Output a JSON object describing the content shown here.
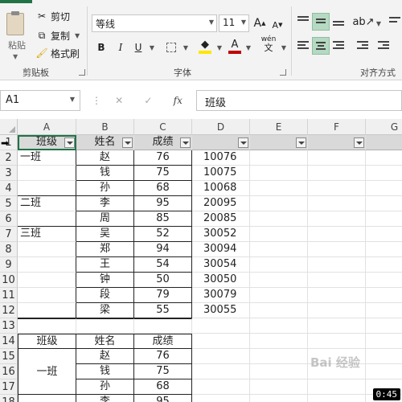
{
  "ribbon": {
    "clipboard": {
      "paste": "粘贴",
      "cut": "剪切",
      "copy": "复制",
      "format_painter": "格式刷",
      "label": "剪贴板"
    },
    "font": {
      "name": "等线",
      "size": "11",
      "grow": "A",
      "shrink": "A",
      "bold": "B",
      "italic": "I",
      "underline": "U",
      "fill_color": "#FFE600",
      "font_color": "#C00000",
      "phonetic": "wén",
      "label": "字体"
    },
    "alignment": {
      "label": "对齐方式"
    },
    "accent": "#217346"
  },
  "formula_bar": {
    "name_box": "A1",
    "fx": "fx",
    "content": "班级"
  },
  "columns": [
    "A",
    "B",
    "C",
    "D",
    "E",
    "F",
    "G"
  ],
  "rows": [
    "1",
    "2",
    "3",
    "4",
    "5",
    "6",
    "7",
    "8",
    "9",
    "10",
    "11",
    "12",
    "13",
    "14",
    "15",
    "16",
    "17",
    "18"
  ],
  "table1": {
    "headers": [
      "班级",
      "姓名",
      "成绩"
    ],
    "class_cells": [
      "一班",
      "",
      "",
      "二班",
      "",
      "三班",
      "",
      "",
      "",
      "",
      ""
    ],
    "names": [
      "赵",
      "钱",
      "孙",
      "李",
      "周",
      "吴",
      "郑",
      "王",
      "钟",
      "段",
      "梁"
    ],
    "scores": [
      "76",
      "75",
      "68",
      "95",
      "85",
      "52",
      "94",
      "54",
      "50",
      "79",
      "55"
    ],
    "ids": [
      "10076",
      "10075",
      "10068",
      "20095",
      "20085",
      "30052",
      "30094",
      "30054",
      "30050",
      "30079",
      "30055"
    ]
  },
  "table2": {
    "headers": [
      "班级",
      "姓名",
      "成绩"
    ],
    "class_label": "一班",
    "names": [
      "赵",
      "钱",
      "孙",
      "李"
    ],
    "scores": [
      "76",
      "75",
      "68",
      "95"
    ]
  },
  "watermark": "Bai 经验",
  "timer": "0:45"
}
